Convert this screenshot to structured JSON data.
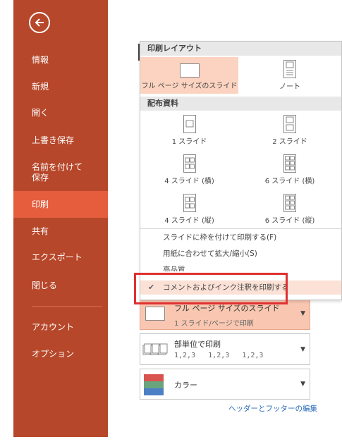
{
  "sidebar": {
    "back_icon": "back-arrow-icon",
    "items": [
      {
        "label": "情報"
      },
      {
        "label": "新規"
      },
      {
        "label": "開く"
      },
      {
        "label": "上書き保存"
      },
      {
        "label": "名前を付けて\n保存"
      },
      {
        "label": "印刷"
      },
      {
        "label": "共有"
      },
      {
        "label": "エクスポート"
      },
      {
        "label": "閉じる"
      },
      {
        "label": "アカウント"
      },
      {
        "label": "オプション"
      }
    ],
    "active_item": "印刷"
  },
  "dropdown": {
    "layout_header": "印刷レイアウト",
    "layout_options": [
      {
        "label": "フル ページ サイズのスライド",
        "selected": true
      },
      {
        "label": "ノート",
        "selected": false
      }
    ],
    "handouts_header": "配布資料",
    "handout_options": [
      {
        "label": "1 スライド"
      },
      {
        "label": "2 スライド"
      },
      {
        "label": "4 スライド (横)"
      },
      {
        "label": "6 スライド (横)"
      },
      {
        "label": "4 スライド (縦)"
      },
      {
        "label": "6 スライド (縦)"
      }
    ],
    "menu_items": [
      {
        "label": "スライドに枠を付けて印刷する(F)",
        "checked": false
      },
      {
        "label": "用紙に合わせて拡大/縮小(S)",
        "checked": false
      },
      {
        "label": "高品質",
        "checked": false
      },
      {
        "label": "コメントおよびインク注釈を印刷する",
        "checked": true
      }
    ]
  },
  "settings": {
    "layout": {
      "title": "フル ページ サイズのスライド",
      "sub": "1 スライド/ページで印刷"
    },
    "collate": {
      "title": "部単位で印刷",
      "sub": "1,2,3   1,2,3   1,2,3"
    },
    "color": {
      "title": "カラー"
    }
  },
  "footer_link": "ヘッダーとフッターの編集",
  "colors": {
    "sidebar": "#b7472a",
    "active": "#e65d3d",
    "selected": "#fbd3c0",
    "highlight": "#e03030",
    "link": "#2a6ab8"
  }
}
